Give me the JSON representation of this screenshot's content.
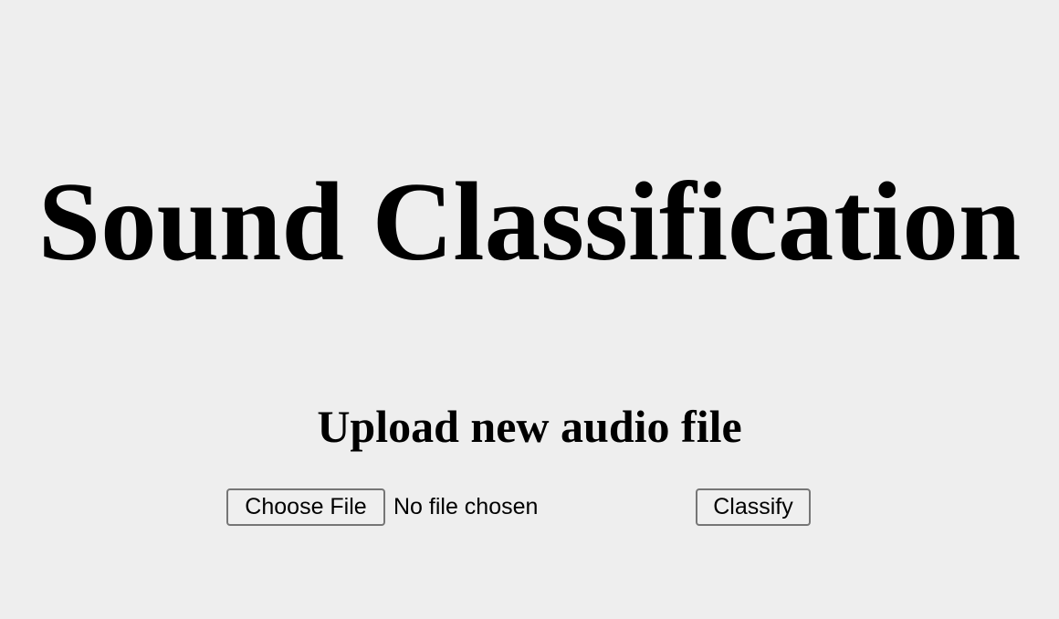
{
  "title": "Sound Classification",
  "upload": {
    "heading": "Upload new audio file",
    "choose_file_label": "Choose File",
    "file_status": "No file chosen",
    "submit_label": "Classify"
  }
}
